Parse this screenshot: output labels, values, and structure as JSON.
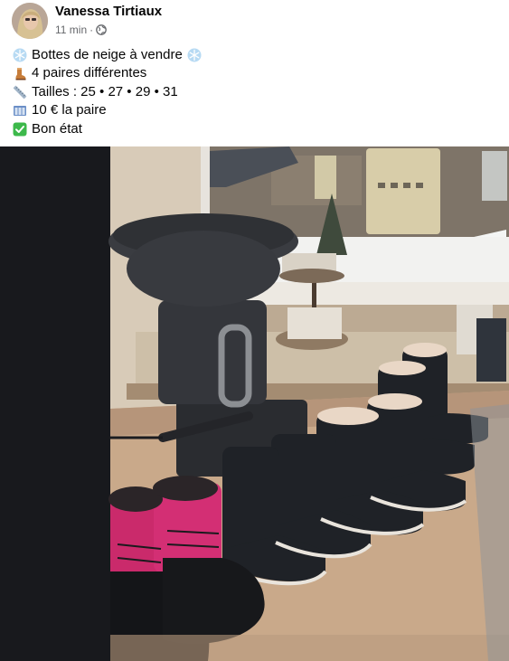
{
  "post": {
    "author": "Vanessa Tirtiaux",
    "time": "11 min",
    "separator": "·",
    "audience_icon": "globe-icon",
    "lines": [
      {
        "icon": "snowflake-icon",
        "text": "Bottes de neige à vendre",
        "trailing_icon": "snowflake-icon"
      },
      {
        "icon": "boot-icon",
        "text": "4 paires différentes"
      },
      {
        "icon": "ruler-icon",
        "text": "Tailles : 25 • 27 • 29 • 31"
      },
      {
        "icon": "banknote-icon",
        "text": "10 € la paire"
      },
      {
        "icon": "check-mark-button-icon",
        "text": "Bon état"
      }
    ]
  },
  "photo": {
    "subject": "snow-boots-photo"
  },
  "colors": {
    "name": "#050505",
    "meta": "#65676b",
    "photo_letterbox": "#18191d",
    "check": "#3db94b"
  }
}
